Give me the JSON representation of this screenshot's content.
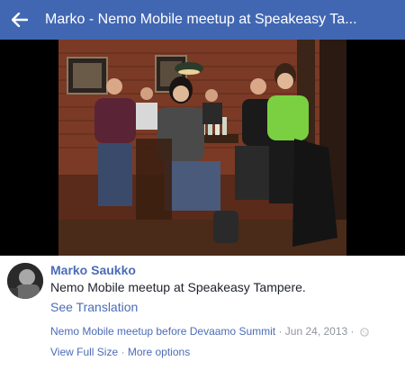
{
  "header": {
    "back_icon": "arrow-left-icon",
    "title": "Marko - Nemo Mobile meetup at Speakeasy Ta..."
  },
  "photo": {
    "description_icon": "photo"
  },
  "post": {
    "author": "Marko Saukko",
    "caption": "Nemo Mobile meetup at Speakeasy Tampere.",
    "see_translation": "See Translation",
    "album": "Nemo Mobile meetup before Devaamo Summit",
    "separator": "·",
    "date": "Jun 24, 2013",
    "privacy_icon": "globe-icon",
    "view_full_size": "View Full Size",
    "more_options": "More options"
  },
  "colors": {
    "header_bg": "#4267b2",
    "link": "#4b6cb7",
    "muted": "#90949c"
  }
}
